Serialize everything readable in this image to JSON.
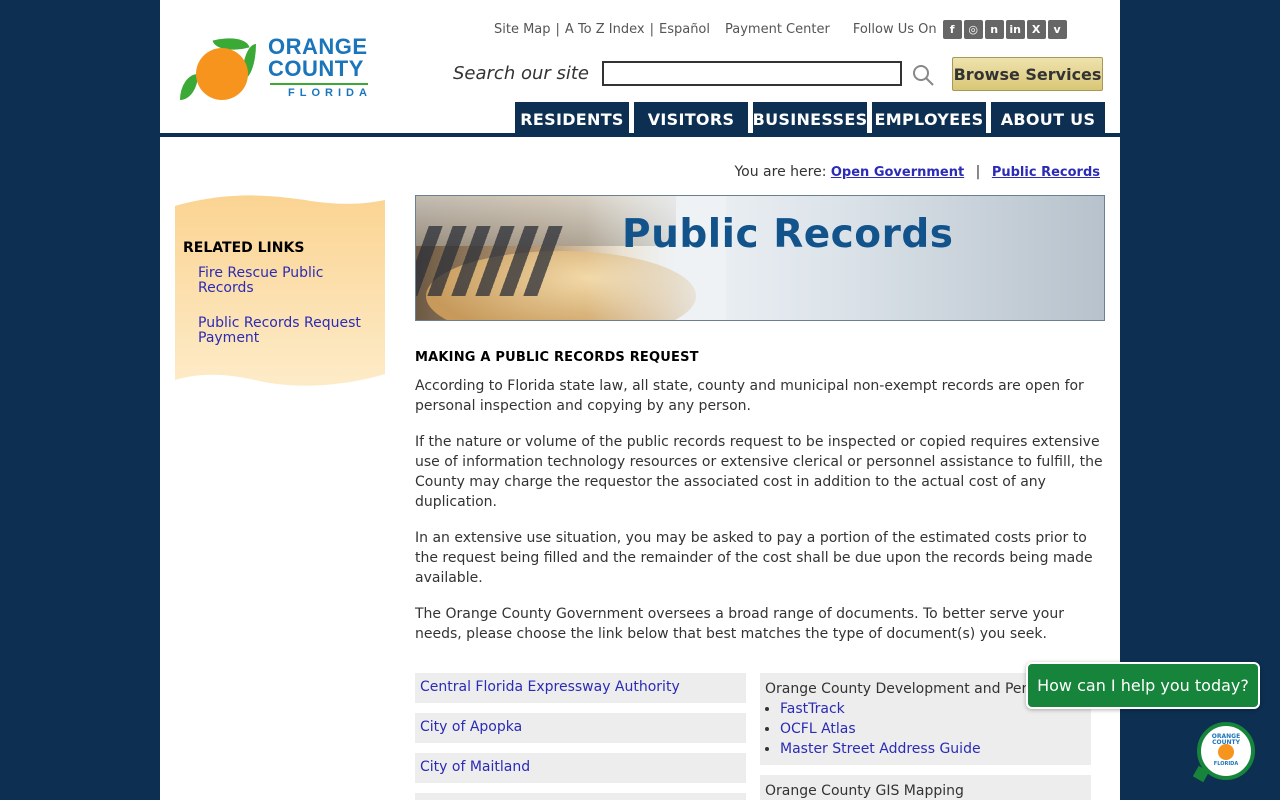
{
  "header": {
    "logo": {
      "line1": "ORANGE",
      "line2": "COUNTY",
      "line3": "FLORIDA"
    },
    "toplinks": {
      "site_map": "Site Map",
      "sep": "|",
      "a_to_z": "A To Z Index",
      "espanol": "Español",
      "payment_center": "Payment Center",
      "follow_us": "Follow Us On"
    },
    "social_icons": [
      "facebook-icon",
      "instagram-icon",
      "nextdoor-icon",
      "linkedin-icon",
      "x-icon",
      "vimeo-icon"
    ],
    "search": {
      "label": "Search our site",
      "value": "",
      "placeholder": ""
    },
    "browse_button": "Browse Services",
    "nav": [
      {
        "label": "RESIDENTS"
      },
      {
        "label": "VISITORS"
      },
      {
        "label": "BUSINESSES"
      },
      {
        "label": "EMPLOYEES"
      },
      {
        "label": "ABOUT US"
      }
    ]
  },
  "breadcrumb": {
    "prefix": "You are here:",
    "items": [
      "Open Government",
      "Public Records"
    ],
    "sep": "|"
  },
  "sidebar": {
    "title": "RELATED LINKS",
    "links": [
      "Fire Rescue Public Records",
      "Public Records Request Payment"
    ]
  },
  "banner": {
    "title": "Public Records"
  },
  "content": {
    "heading": "MAKING A PUBLIC RECORDS REQUEST",
    "paragraphs": [
      "According to Florida state law, all state, county and municipal non-exempt records are open for personal inspection and copying by any person.",
      "If the nature or volume of the public records request to be inspected or copied requires extensive use of information technology resources or extensive clerical or personnel assistance to fulfill, the County may charge the requestor the associated cost in addition to the actual cost of any duplication.",
      "In an extensive use situation, you may be asked to pay a portion of the estimated costs prior to the request being filled and the remainder of the cost shall be due upon the records being made available.",
      "The Orange County Government oversees a broad range of documents. To better serve your needs, please choose the link below that best matches the type of document(s) you seek."
    ]
  },
  "left_links": [
    "Central Florida Expressway Authority",
    "City of Apopka",
    "City of Maitland"
  ],
  "right_boxes": {
    "box1_title": "Orange County Development and Permitting",
    "box1_links": [
      "FastTrack",
      "OCFL Atlas",
      "Master Street Address Guide"
    ],
    "box2_title": "Orange County GIS Mapping"
  },
  "chat": {
    "prompt": "How can I help you today?",
    "avatar_line1": "ORANGE",
    "avatar_line2": "COUNTY",
    "avatar_line3": "FLORIDA"
  },
  "colors": {
    "navy": "#0d2f52",
    "link": "#2b2bb5",
    "brand_blue": "#1b75bb",
    "brand_green": "#3aa935",
    "orange": "#f7941d",
    "chat_green": "#16843a"
  }
}
